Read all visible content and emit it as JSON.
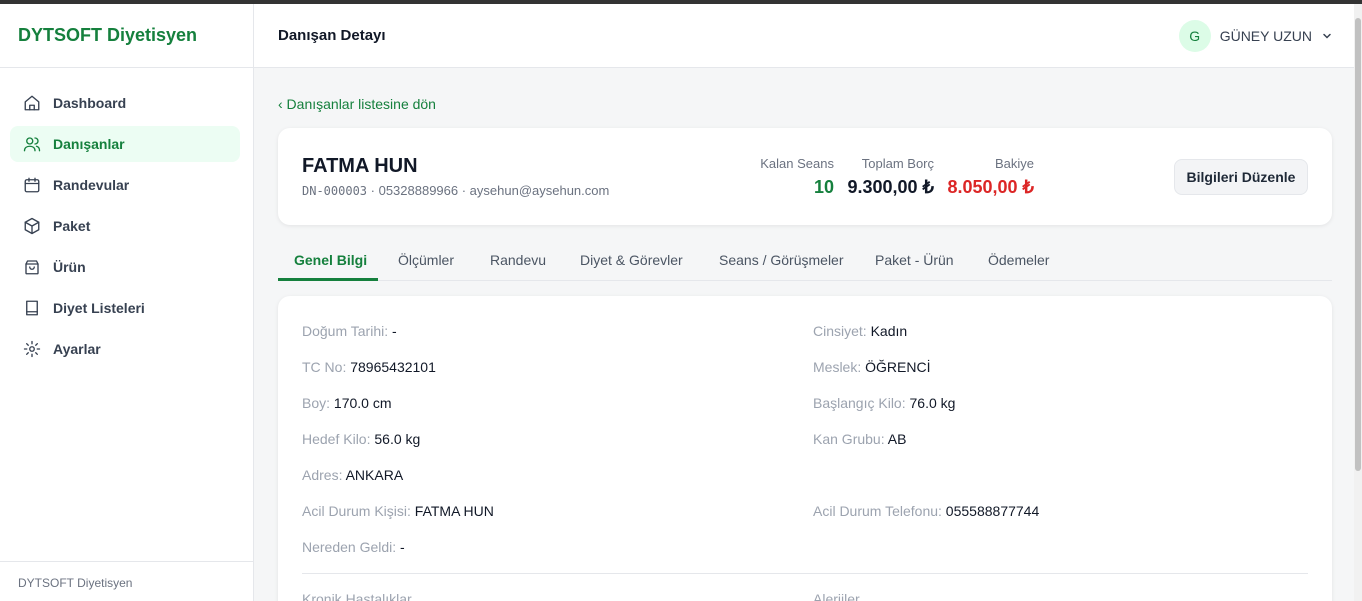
{
  "brand": "DYTSOFT Diyetisyen",
  "sidebar": {
    "items": [
      {
        "label": "Dashboard",
        "icon": "home-icon"
      },
      {
        "label": "Danışanlar",
        "icon": "users-icon",
        "active": true
      },
      {
        "label": "Randevular",
        "icon": "calendar-icon"
      },
      {
        "label": "Paket",
        "icon": "box-icon"
      },
      {
        "label": "Ürün",
        "icon": "bag-icon"
      },
      {
        "label": "Diyet Listeleri",
        "icon": "book-icon"
      },
      {
        "label": "Ayarlar",
        "icon": "gear-icon"
      }
    ],
    "footer": "DYTSOFT Diyetisyen"
  },
  "header": {
    "title": "Danışan Detayı",
    "user": {
      "initial": "G",
      "name": "GÜNEY UZUN"
    }
  },
  "back_link": "‹ Danışanlar listesine dön",
  "client": {
    "name": "FATMA HUN",
    "code": "DN-000003",
    "meta_rest": " · 05328889966 · aysehun@aysehun.com",
    "stats": {
      "remaining_label": "Kalan Seans",
      "remaining_value": "10",
      "debt_label": "Toplam Borç",
      "debt_value": "9.300,00 ₺",
      "balance_label": "Bakiye",
      "balance_value": "8.050,00 ₺"
    },
    "edit_button": "Bilgileri Düzenle"
  },
  "tabs": [
    "Genel Bilgi",
    "Ölçümler",
    "Randevu",
    "Diyet & Görevler",
    "Seans / Görüşmeler",
    "Paket - Ürün",
    "Ödemeler"
  ],
  "details": {
    "birth": {
      "k": "Doğum Tarihi:",
      "v": " -"
    },
    "gender": {
      "k": "Cinsiyet:",
      "v": " Kadın"
    },
    "tc": {
      "k": "TC No:",
      "v": " 78965432101"
    },
    "job": {
      "k": "Meslek:",
      "v": " ÖĞRENCİ"
    },
    "height": {
      "k": "Boy:",
      "v": " 170.0 cm"
    },
    "start_weight": {
      "k": "Başlangıç Kilo:",
      "v": " 76.0 kg"
    },
    "target_weight": {
      "k": "Hedef Kilo:",
      "v": " 56.0 kg"
    },
    "blood": {
      "k": "Kan Grubu:",
      "v": " AB"
    },
    "address": {
      "k": "Adres:",
      "v": " ANKARA"
    },
    "emergency_person": {
      "k": "Acil Durum Kişisi:",
      "v": " FATMA HUN"
    },
    "emergency_phone": {
      "k": "Acil Durum Telefonu:",
      "v": " 055588877744"
    },
    "source": {
      "k": "Nereden Geldi:",
      "v": " -"
    },
    "chronic": "Kronik Hastalıklar",
    "allergies": "Alerjiler"
  },
  "colors": {
    "accent": "#15803d",
    "danger": "#dc2626"
  }
}
